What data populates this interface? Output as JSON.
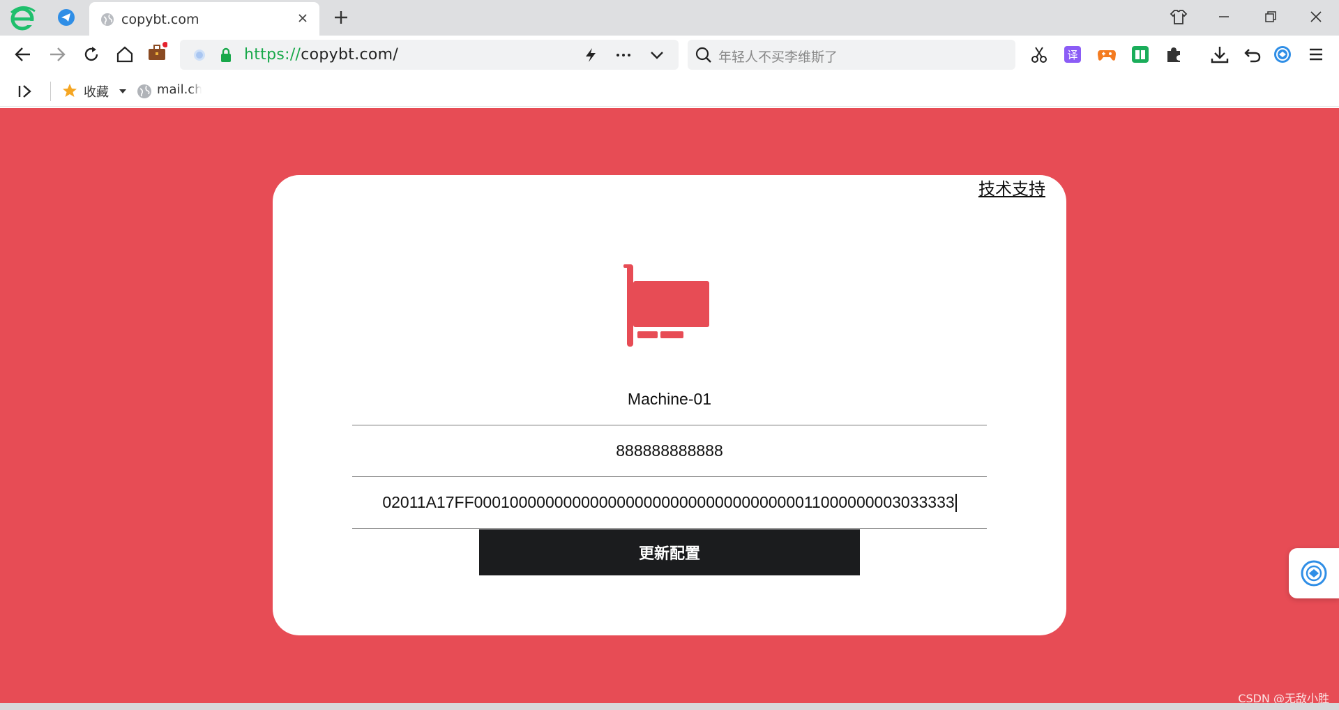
{
  "browser": {
    "tab_title": "copybt.com",
    "address_scheme": "https://",
    "address_rest": "copybt.com/",
    "search_placeholder": "年轻人不买李维斯了"
  },
  "bookmarks": {
    "favorites_label": "收藏",
    "item_1": "mail.ch"
  },
  "page": {
    "support_link": "技术支持",
    "machine_name": "Machine-01",
    "code_value": "888888888888",
    "config_value": "02011A17FF000100000000000000000000000000000000011000000003033333",
    "submit_label": "更新配置"
  },
  "watermark": "CSDN @无敌小胜",
  "colors": {
    "page_background": "#e74c55",
    "card_background": "#ffffff",
    "button_background": "#1b1c1e",
    "icon_color": "#e74c55",
    "url_scheme_green": "#18a84a"
  },
  "icons": {
    "browser_logo": "browser-e-logo-icon",
    "nic": "network-card-icon",
    "pinned": "telegram-plane-icon"
  }
}
